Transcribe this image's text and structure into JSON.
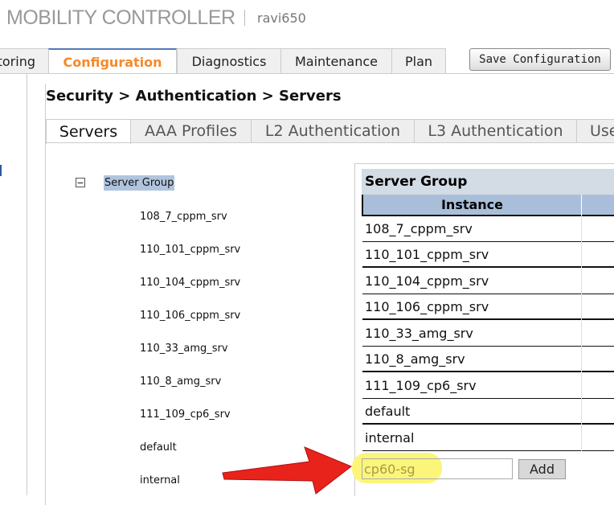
{
  "header": {
    "brand": "MOBILITY CONTROLLER",
    "hostname": "ravi650"
  },
  "nav": {
    "tabs": [
      "toring",
      "Configuration",
      "Diagnostics",
      "Maintenance",
      "Plan"
    ],
    "active": "Configuration",
    "save_label": "Save Configuration"
  },
  "breadcrumb": "Security > Authentication > Servers",
  "subtabs": [
    "Servers",
    "AAA Profiles",
    "L2 Authentication",
    "L3 Authentication",
    "Use"
  ],
  "tree": {
    "root": "Server Group",
    "items": [
      "108_7_cppm_srv",
      "110_101_cppm_srv",
      "110_104_cppm_srv",
      "110_106_cppm_srv",
      "110_33_amg_srv",
      "110_8_amg_srv",
      "111_109_cp6_srv",
      "default",
      "internal"
    ]
  },
  "table": {
    "title": "Server Group",
    "column": "Instance",
    "rows": [
      "108_7_cppm_srv",
      "110_101_cppm_srv",
      "110_104_cppm_srv",
      "110_106_cppm_srv",
      "110_33_amg_srv",
      "110_8_amg_srv",
      "111_109_cp6_srv",
      "default",
      "internal"
    ]
  },
  "form": {
    "input_value": "cp60-sg",
    "add_label": "Add"
  },
  "colors": {
    "accent": "#f5892b",
    "highlight": "#fbf57a",
    "arrow": "#e8231b",
    "header_bg": "#a9bfd9"
  }
}
